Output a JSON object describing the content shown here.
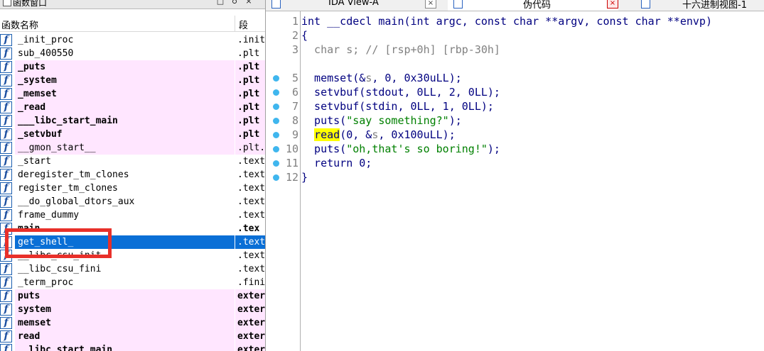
{
  "left_pane": {
    "title": "函数窗口",
    "btn_restore": "□",
    "btn_pin": "♁",
    "btn_close": "×",
    "col_name": "函数名称",
    "col_segment": "段",
    "functions": [
      {
        "name": "_init_proc",
        "segment": ".init",
        "pink": false,
        "bold": false
      },
      {
        "name": "sub_400550",
        "segment": ".plt",
        "pink": false,
        "bold": false
      },
      {
        "name": "_puts",
        "segment": ".plt",
        "pink": true,
        "bold": true
      },
      {
        "name": "_system",
        "segment": ".plt",
        "pink": true,
        "bold": true
      },
      {
        "name": "_memset",
        "segment": ".plt",
        "pink": true,
        "bold": true
      },
      {
        "name": "_read",
        "segment": ".plt",
        "pink": true,
        "bold": true
      },
      {
        "name": "___libc_start_main",
        "segment": ".plt",
        "pink": true,
        "bold": true
      },
      {
        "name": "_setvbuf",
        "segment": ".plt",
        "pink": true,
        "bold": true
      },
      {
        "name": "__gmon_start__",
        "segment": ".plt.",
        "pink": true,
        "bold": false
      },
      {
        "name": "_start",
        "segment": ".text",
        "pink": false,
        "bold": false
      },
      {
        "name": "deregister_tm_clones",
        "segment": ".text",
        "pink": false,
        "bold": false
      },
      {
        "name": "register_tm_clones",
        "segment": ".text",
        "pink": false,
        "bold": false
      },
      {
        "name": "__do_global_dtors_aux",
        "segment": ".text",
        "pink": false,
        "bold": false
      },
      {
        "name": "frame_dummy",
        "segment": ".text",
        "pink": false,
        "bold": false
      },
      {
        "name": "main",
        "segment": ".tex",
        "pink": false,
        "bold": true
      },
      {
        "name": "get_shell_",
        "segment": ".text",
        "pink": false,
        "bold": false,
        "selected": true
      },
      {
        "name": "__libc_csu_init",
        "segment": ".text",
        "pink": false,
        "bold": false
      },
      {
        "name": "__libc_csu_fini",
        "segment": ".text",
        "pink": false,
        "bold": false
      },
      {
        "name": "_term_proc",
        "segment": ".fini",
        "pink": false,
        "bold": false
      },
      {
        "name": "puts",
        "segment": "exter",
        "pink": true,
        "bold": true
      },
      {
        "name": "system",
        "segment": "exter",
        "pink": true,
        "bold": true
      },
      {
        "name": "memset",
        "segment": "exter",
        "pink": true,
        "bold": true
      },
      {
        "name": "read",
        "segment": "exter",
        "pink": true,
        "bold": true
      },
      {
        "name": "__libc_start_main",
        "segment": "exter",
        "pink": true,
        "bold": true
      }
    ]
  },
  "tabs": [
    {
      "label": "IDA View-A",
      "close": "×",
      "active": false
    },
    {
      "label": "伪代码",
      "close": "×",
      "active": true
    },
    {
      "label": "十六进制视图-1",
      "close": "",
      "active": false
    }
  ],
  "code": {
    "lines": [
      {
        "num": "1",
        "bp": false,
        "tokens": [
          {
            "t": "int __cdecl main(int argc, const char **argv, const char **envp)",
            "c": "k-navy"
          }
        ]
      },
      {
        "num": "2",
        "bp": false,
        "tokens": [
          {
            "t": "{",
            "c": "k-navy"
          }
        ]
      },
      {
        "num": "3",
        "bp": false,
        "tokens": [
          {
            "t": "  char s; ",
            "c": "k-gray"
          },
          {
            "t": "// [rsp+0h] [rbp-30h]",
            "c": "k-gray"
          }
        ]
      },
      {
        "num": "",
        "bp": false,
        "tokens": []
      },
      {
        "num": "5",
        "bp": true,
        "tokens": [
          {
            "t": "  memset(&",
            "c": "k-navy"
          },
          {
            "t": "s",
            "c": "k-gray"
          },
          {
            "t": ", 0, 0x30uLL);",
            "c": "k-navy"
          }
        ]
      },
      {
        "num": "6",
        "bp": true,
        "tokens": [
          {
            "t": "  setvbuf(stdout, 0LL, 2, 0LL);",
            "c": "k-navy"
          }
        ]
      },
      {
        "num": "7",
        "bp": true,
        "tokens": [
          {
            "t": "  setvbuf(stdin, 0LL, 1, 0LL);",
            "c": "k-navy"
          }
        ]
      },
      {
        "num": "8",
        "bp": true,
        "tokens": [
          {
            "t": "  puts(",
            "c": "k-navy"
          },
          {
            "t": "\"say something?\"",
            "c": "k-green"
          },
          {
            "t": ");",
            "c": "k-navy"
          }
        ]
      },
      {
        "num": "9",
        "bp": true,
        "tokens": [
          {
            "t": "  ",
            "c": "k-navy"
          },
          {
            "t": "read",
            "c": "k-hl"
          },
          {
            "t": "(0, &",
            "c": "k-navy"
          },
          {
            "t": "s",
            "c": "k-gray"
          },
          {
            "t": ", 0x100uLL);",
            "c": "k-navy"
          }
        ]
      },
      {
        "num": "10",
        "bp": true,
        "tokens": [
          {
            "t": "  puts(",
            "c": "k-navy"
          },
          {
            "t": "\"oh,that's so boring!\"",
            "c": "k-green"
          },
          {
            "t": ");",
            "c": "k-navy"
          }
        ]
      },
      {
        "num": "11",
        "bp": true,
        "tokens": [
          {
            "t": "  return 0;",
            "c": "k-navy"
          }
        ]
      },
      {
        "num": "12",
        "bp": true,
        "tokens": [
          {
            "t": "}",
            "c": "k-navy"
          }
        ]
      }
    ]
  },
  "colors": {
    "selected": "#0a6fd6",
    "pink": "#ffe6ff",
    "highlight_box": "#e8302a",
    "breakpoint": "#3fb6ee"
  }
}
